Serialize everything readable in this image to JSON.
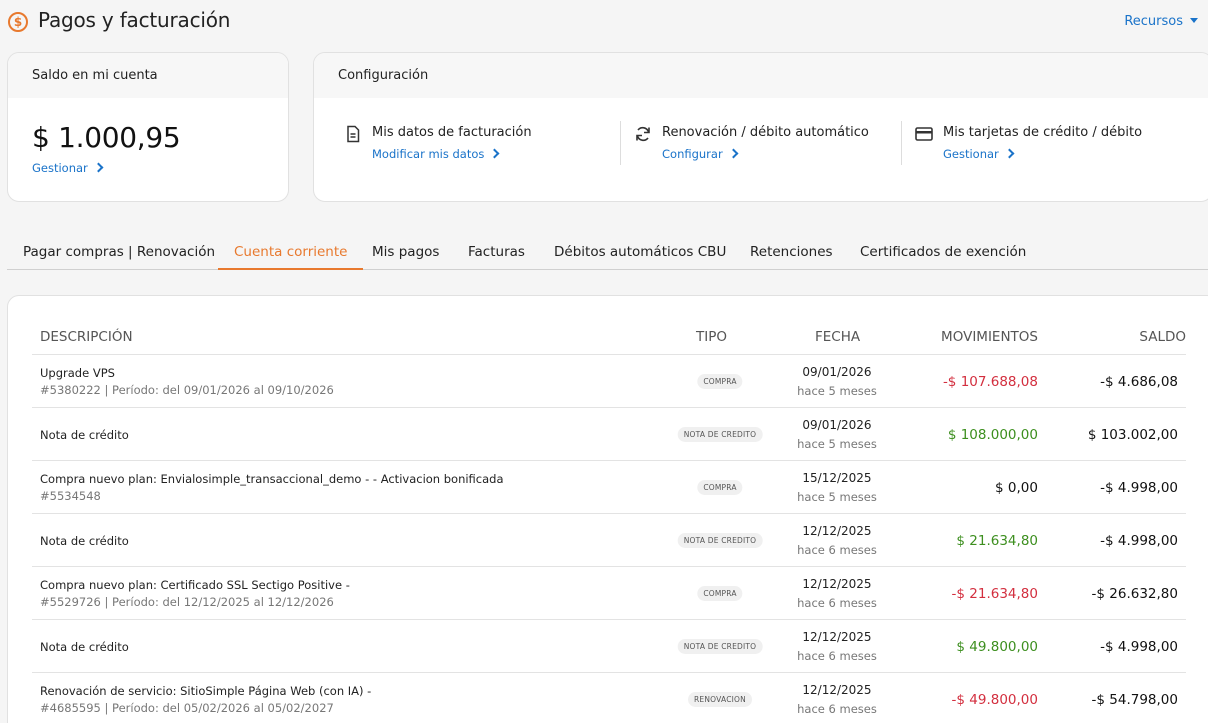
{
  "header": {
    "icon": "dollar-circle-icon",
    "title": "Pagos y facturación",
    "resources_label": "Recursos"
  },
  "balance_card": {
    "title": "Saldo en mi cuenta",
    "amount": "$ 1.000,95",
    "manage_label": "Gestionar"
  },
  "config_card": {
    "title": "Configuración",
    "items": [
      {
        "icon": "document-icon",
        "title": "Mis datos de facturación",
        "link": "Modificar mis datos"
      },
      {
        "icon": "refresh-icon",
        "title": "Renovación / débito automático",
        "link": "Configurar"
      },
      {
        "icon": "credit-card-icon",
        "title": "Mis tarjetas de crédito / débito",
        "link": "Gestionar"
      }
    ]
  },
  "tabs": [
    {
      "label": "Pagar compras | Renovación"
    },
    {
      "label": "Cuenta corriente",
      "active": true
    },
    {
      "label": "Mis pagos"
    },
    {
      "label": "Facturas"
    },
    {
      "label": "Débitos automáticos CBU"
    },
    {
      "label": "Retenciones"
    },
    {
      "label": "Certificados de exención"
    }
  ],
  "table": {
    "columns": [
      "DESCRIPCIÓN",
      "TIPO",
      "FECHA",
      "MOVIMIENTOS",
      "SALDO"
    ],
    "rows": [
      {
        "desc": "Upgrade VPS",
        "id": "#5380222",
        "period_label": "Período:",
        "period": "del 09/01/2026 al 09/10/2026",
        "type": "COMPRA",
        "date": "09/01/2026",
        "ago": "hace 5 meses",
        "movement": "-$ 107.688,08",
        "movement_kind": "neg",
        "balance": "-$ 4.686,08"
      },
      {
        "desc": "Nota de crédito",
        "id": "",
        "period_label": "",
        "period": "",
        "type": "NOTA DE CREDITO",
        "date": "09/01/2026",
        "ago": "hace 5 meses",
        "movement": "$ 108.000,00",
        "movement_kind": "pos",
        "balance": "$ 103.002,00"
      },
      {
        "desc": "Compra nuevo plan: Envialosimple_transaccional_demo - - Activacion bonificada",
        "id": "#5534548",
        "period_label": "",
        "period": "",
        "type": "COMPRA",
        "date": "15/12/2025",
        "ago": "hace 5 meses",
        "movement": "$ 0,00",
        "movement_kind": "zero",
        "balance": "-$ 4.998,00"
      },
      {
        "desc": "Nota de crédito",
        "id": "",
        "period_label": "",
        "period": "",
        "type": "NOTA DE CREDITO",
        "date": "12/12/2025",
        "ago": "hace 6 meses",
        "movement": "$ 21.634,80",
        "movement_kind": "pos",
        "balance": "-$ 4.998,00"
      },
      {
        "desc": "Compra nuevo plan: Certificado SSL Sectigo Positive -",
        "id": "#5529726",
        "period_label": "Período:",
        "period": "del 12/12/2025 al 12/12/2026",
        "type": "COMPRA",
        "date": "12/12/2025",
        "ago": "hace 6 meses",
        "movement": "-$ 21.634,80",
        "movement_kind": "neg",
        "balance": "-$ 26.632,80"
      },
      {
        "desc": "Nota de crédito",
        "id": "",
        "period_label": "",
        "period": "",
        "type": "NOTA DE CREDITO",
        "date": "12/12/2025",
        "ago": "hace 6 meses",
        "movement": "$ 49.800,00",
        "movement_kind": "pos",
        "balance": "-$ 4.998,00"
      },
      {
        "desc": "Renovación de servicio: SitioSimple Página Web (con IA) -",
        "id": "#4685595",
        "period_label": "Período:",
        "period": "del 05/02/2026 al 05/02/2027",
        "type": "RENOVACION",
        "date": "12/12/2025",
        "ago": "hace 6 meses",
        "movement": "-$ 49.800,00",
        "movement_kind": "neg",
        "balance": "-$ 54.798,00"
      }
    ]
  },
  "colors": {
    "accent_orange": "#e8792e",
    "link_blue": "#1a73c9",
    "negative_red": "#d32f3f",
    "positive_green": "#3d8f1f"
  }
}
